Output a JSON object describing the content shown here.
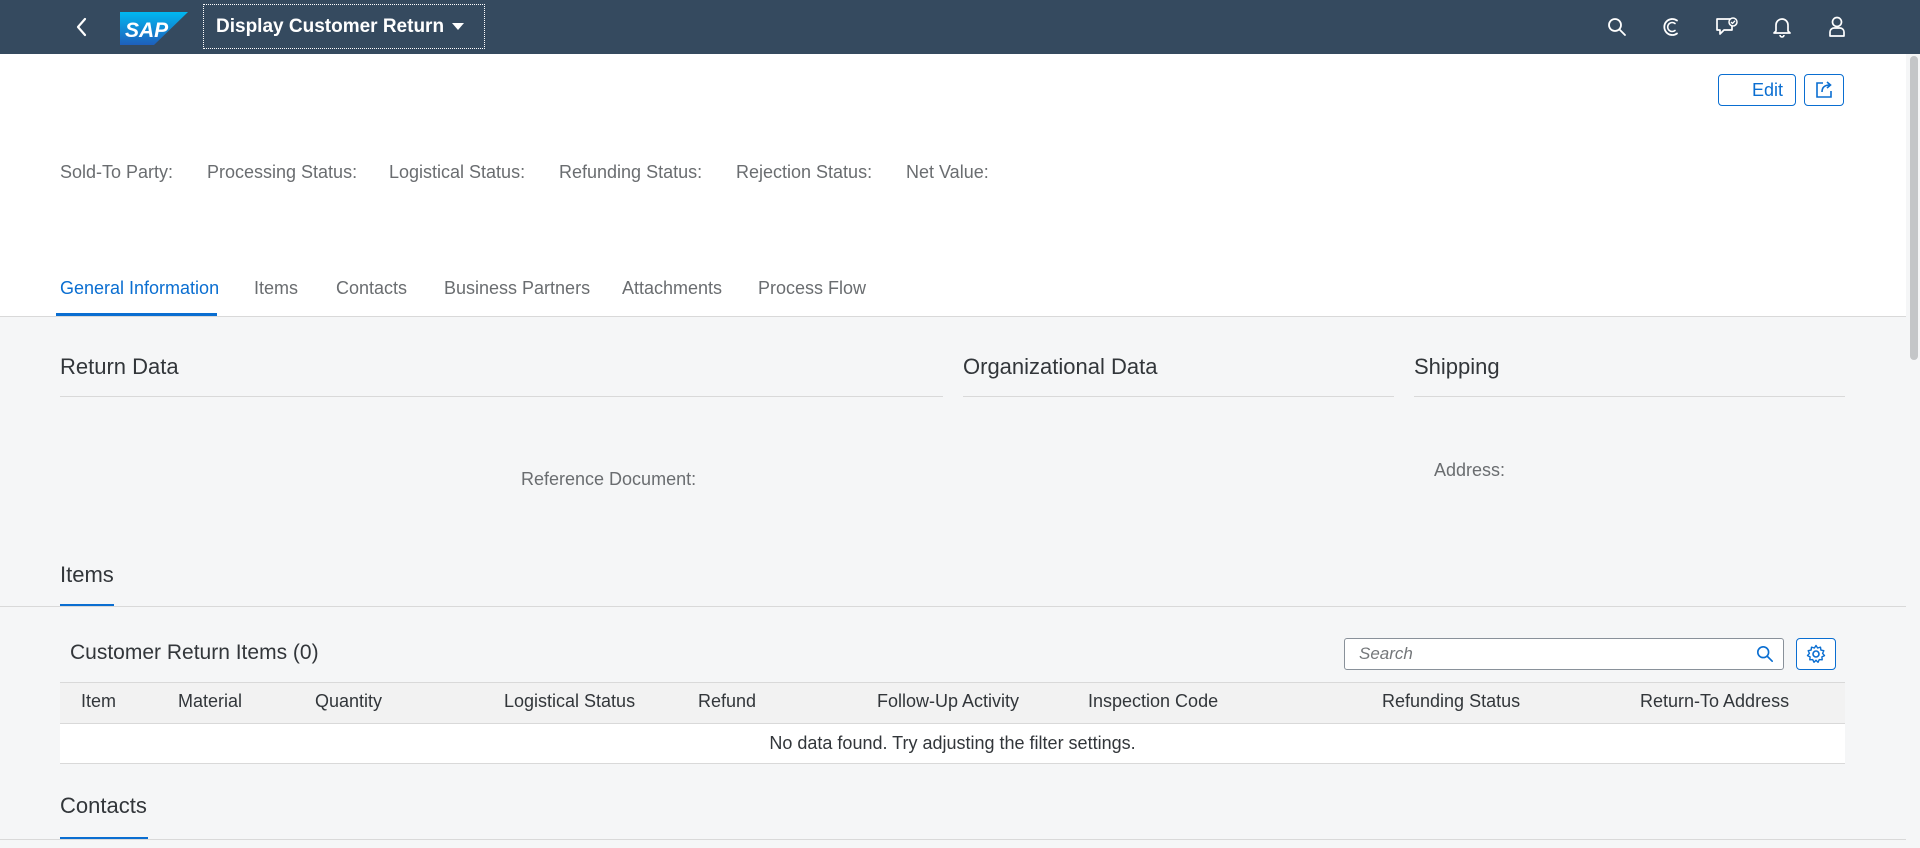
{
  "shell": {
    "app_title": "Display Customer Return",
    "logo_text": "SAP",
    "icons": [
      "back-icon",
      "search-icon",
      "copilot-icon",
      "feedback-icon",
      "notifications-icon",
      "user-icon"
    ]
  },
  "header": {
    "edit_label": "Edit",
    "kpis": [
      "Sold-To Party:",
      "Processing Status:",
      "Logistical Status:",
      "Refunding Status:",
      "Rejection Status:",
      "Net Value:"
    ]
  },
  "tabs": [
    "General Information",
    "Items",
    "Contacts",
    "Business Partners",
    "Attachments",
    "Process Flow"
  ],
  "general_information": {
    "return_data": {
      "title": "Return Data",
      "reference_document_label": "Reference Document:"
    },
    "organizational_data": {
      "title": "Organizational Data"
    },
    "shipping": {
      "title": "Shipping",
      "address_label": "Address:"
    }
  },
  "items_section": {
    "title": "Items",
    "table_title": "Customer Return Items (0)",
    "search_placeholder": "Search",
    "columns": [
      "Item",
      "Material",
      "Quantity",
      "Logistical Status",
      "Refund",
      "Follow-Up Activity",
      "Inspection Code",
      "Refunding Status",
      "Return-To Address"
    ],
    "empty_text": "No data found. Try adjusting the filter settings."
  },
  "contacts_section": {
    "title": "Contacts"
  },
  "colors": {
    "shell_background": "#354a5f",
    "accent": "#0a6ed1",
    "page_background": "#f5f6f7"
  }
}
